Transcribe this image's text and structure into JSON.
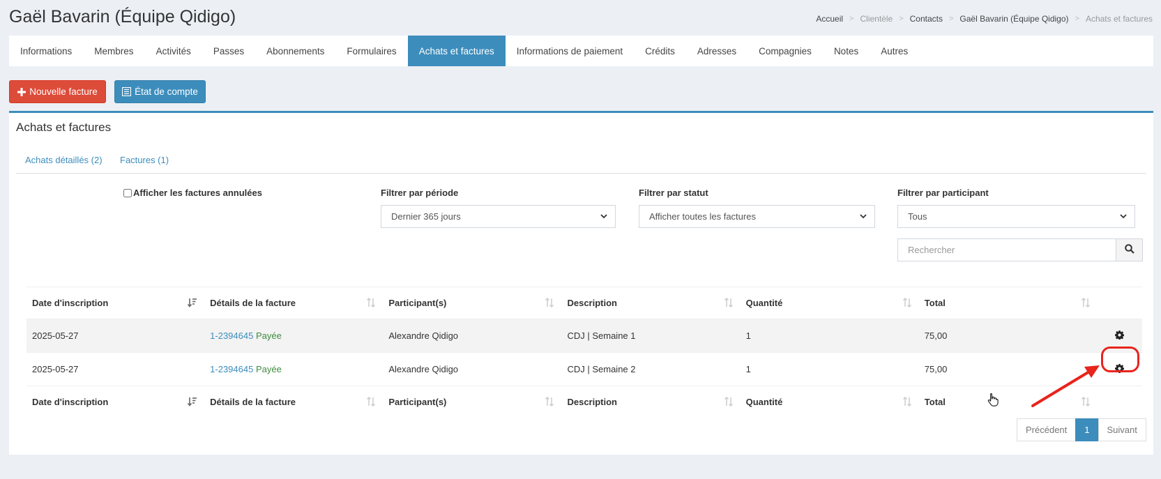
{
  "header": {
    "title": "Gaël Bavarin (Équipe Qidigo)",
    "breadcrumb": [
      {
        "label": "Accueil"
      },
      {
        "label": "Clientèle"
      },
      {
        "label": "Contacts"
      },
      {
        "label": "Gaël Bavarin (Équipe Qidigo)"
      },
      {
        "label": "Achats et factures"
      }
    ]
  },
  "tabs": [
    {
      "label": "Informations"
    },
    {
      "label": "Membres"
    },
    {
      "label": "Activités"
    },
    {
      "label": "Passes"
    },
    {
      "label": "Abonnements"
    },
    {
      "label": "Formulaires"
    },
    {
      "label": "Achats et factures"
    },
    {
      "label": "Informations de paiement"
    },
    {
      "label": "Crédits"
    },
    {
      "label": "Adresses"
    },
    {
      "label": "Compagnies"
    },
    {
      "label": "Notes"
    },
    {
      "label": "Autres"
    }
  ],
  "actions": {
    "new_invoice": "Nouvelle facture",
    "statement": "État de compte"
  },
  "box": {
    "title": "Achats et factures",
    "subtabs": [
      {
        "label": "Achats détaillés (2)"
      },
      {
        "label": "Factures (1)"
      }
    ]
  },
  "filters": {
    "show_cancelled": "Afficher les factures annulées",
    "period": {
      "label": "Filtrer par période",
      "value": "Dernier 365 jours"
    },
    "status": {
      "label": "Filtrer par statut",
      "value": "Afficher toutes les factures"
    },
    "participant": {
      "label": "Filtrer par participant",
      "value": "Tous"
    },
    "search_placeholder": "Rechercher"
  },
  "table": {
    "columns": [
      "Date d'inscription",
      "Détails de la facture",
      "Participant(s)",
      "Description",
      "Quantité",
      "Total"
    ],
    "rows": [
      {
        "date": "2025-05-27",
        "invoice": "1-2394645",
        "status": "Payée",
        "participant": "Alexandre Qidigo",
        "description": "CDJ | Semaine 1",
        "quantity": "1",
        "total": "75,00"
      },
      {
        "date": "2025-05-27",
        "invoice": "1-2394645",
        "status": "Payée",
        "participant": "Alexandre Qidigo",
        "description": "CDJ | Semaine 2",
        "quantity": "1",
        "total": "75,00"
      }
    ]
  },
  "pagination": {
    "prev": "Précédent",
    "page": "1",
    "next": "Suivant"
  },
  "colors": {
    "primary": "#3c8dbc",
    "danger": "#dd4b39",
    "annotation": "#e8241c",
    "paid": "#3d8b3d"
  }
}
